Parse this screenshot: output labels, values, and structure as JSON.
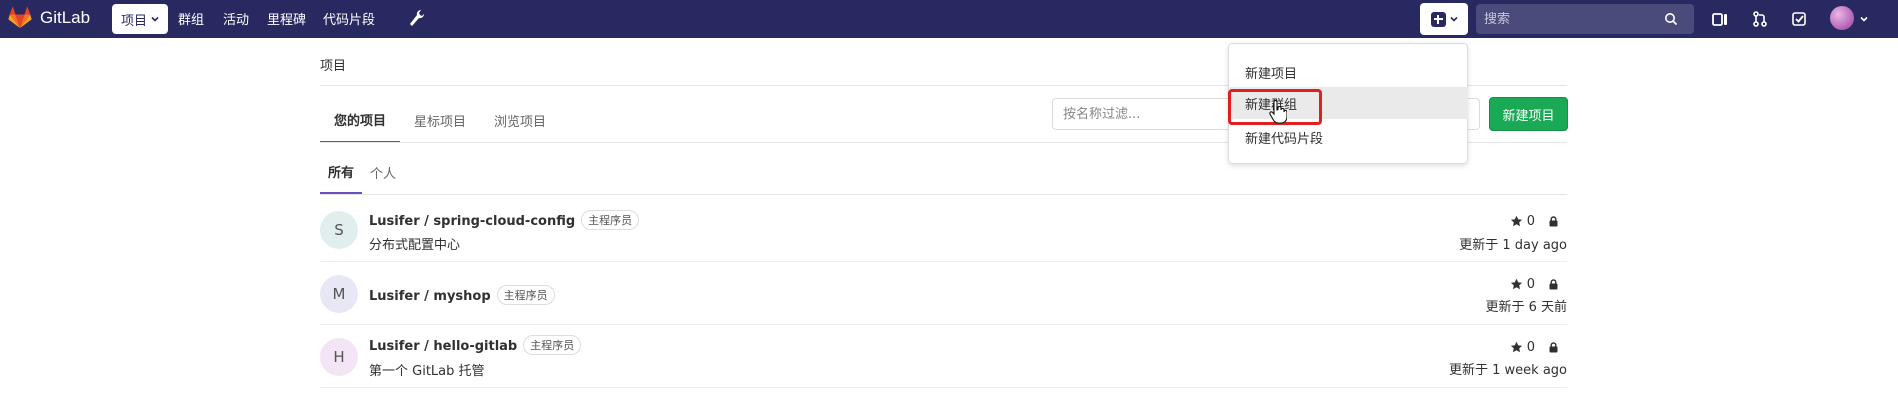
{
  "brand": {
    "name": "GitLab"
  },
  "nav": {
    "projects": "项目",
    "groups": "群组",
    "activity": "活动",
    "milestones": "里程碑",
    "snippets": "代码片段"
  },
  "search": {
    "placeholder": "搜索"
  },
  "breadcrumb": "项目",
  "tabs": [
    "您的项目",
    "星标项目",
    "浏览项目"
  ],
  "filter": {
    "placeholder": "按名称过滤..."
  },
  "new_project_button": "新建项目",
  "subtabs": [
    "所有",
    "个人"
  ],
  "projects": [
    {
      "initial": "S",
      "name": "Lusifer / spring-cloud-config",
      "role": "主程序员",
      "description": "分布式配置中心",
      "stars": "0",
      "updated": "更新于 1 day ago",
      "avatar_color": "#e0eeee"
    },
    {
      "initial": "M",
      "name": "Lusifer / myshop",
      "role": "主程序员",
      "description": "",
      "stars": "0",
      "updated": "更新于 6 天前",
      "avatar_color": "#e7e7f5"
    },
    {
      "initial": "H",
      "name": "Lusifer / hello-gitlab",
      "role": "主程序员",
      "description": "第一个 GitLab 托管",
      "stars": "0",
      "updated": "更新于 1 week ago",
      "avatar_color": "#f3e5f5"
    }
  ],
  "dropdown": {
    "items": [
      "新建项目",
      "新建群组",
      "新建代码片段"
    ]
  },
  "colors": {
    "navbar": "#292961",
    "accent": "#6b4fbb",
    "success": "#1aaa55",
    "highlight": "#e02020"
  }
}
